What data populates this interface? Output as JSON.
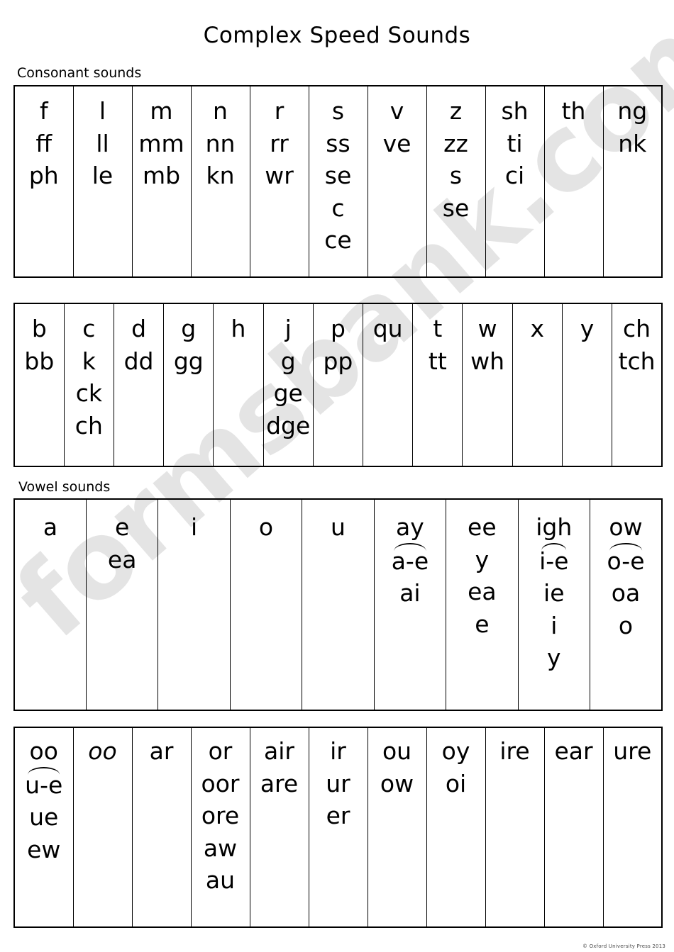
{
  "document": {
    "title": "Complex Speed Sounds",
    "copyright": "© Oxford University Press 2013",
    "watermark": "formsbank.com",
    "watermark_color": "#e4e4e4"
  },
  "sections": {
    "consonant_label": "Consonant sounds",
    "vowel_label": "Vowel sounds"
  },
  "tables": {
    "consonant_1": {
      "columns": [
        {
          "graphemes": [
            "f",
            "ff",
            "ph"
          ]
        },
        {
          "graphemes": [
            "l",
            "ll",
            "le"
          ]
        },
        {
          "graphemes": [
            "m",
            "mm",
            "mb"
          ]
        },
        {
          "graphemes": [
            "n",
            "nn",
            "kn"
          ]
        },
        {
          "graphemes": [
            "r",
            "rr",
            "wr"
          ]
        },
        {
          "graphemes": [
            "s",
            "ss",
            "se",
            "c",
            "ce"
          ]
        },
        {
          "graphemes": [
            "v",
            "ve"
          ]
        },
        {
          "graphemes": [
            "z",
            "zz",
            "s",
            "se"
          ]
        },
        {
          "graphemes": [
            "sh",
            "ti",
            "ci"
          ]
        },
        {
          "graphemes": [
            "th"
          ]
        },
        {
          "graphemes": [
            "ng",
            "nk"
          ]
        }
      ]
    },
    "consonant_2": {
      "columns": [
        {
          "graphemes": [
            "b",
            "bb"
          ]
        },
        {
          "graphemes": [
            "c",
            "k",
            "ck",
            "ch"
          ]
        },
        {
          "graphemes": [
            "d",
            "dd"
          ]
        },
        {
          "graphemes": [
            "g",
            "gg"
          ]
        },
        {
          "graphemes": [
            "h"
          ]
        },
        {
          "graphemes": [
            "j",
            "g",
            "ge",
            "dge"
          ]
        },
        {
          "graphemes": [
            "p",
            "pp"
          ]
        },
        {
          "graphemes": [
            "qu"
          ]
        },
        {
          "graphemes": [
            "t",
            "tt"
          ]
        },
        {
          "graphemes": [
            "w",
            "wh"
          ]
        },
        {
          "graphemes": [
            "x"
          ]
        },
        {
          "graphemes": [
            "y"
          ]
        },
        {
          "graphemes": [
            "ch",
            "tch"
          ]
        }
      ]
    },
    "vowel_1": {
      "columns": [
        {
          "graphemes": [
            "a"
          ]
        },
        {
          "graphemes": [
            "e",
            "ea"
          ]
        },
        {
          "graphemes": [
            "i"
          ]
        },
        {
          "graphemes": [
            "o"
          ]
        },
        {
          "graphemes": [
            "u"
          ]
        },
        {
          "graphemes": [
            "ay",
            "a-e",
            "ai"
          ],
          "arc_index": 1
        },
        {
          "graphemes": [
            "ee",
            "y",
            "ea",
            "e"
          ]
        },
        {
          "graphemes": [
            "igh",
            "i-e",
            "ie",
            "i",
            "y"
          ],
          "arc_index": 1
        },
        {
          "graphemes": [
            "ow",
            "o-e",
            "oa",
            "o"
          ],
          "arc_index": 1
        }
      ]
    },
    "vowel_2": {
      "columns": [
        {
          "graphemes": [
            "oo",
            "u-e",
            "ue",
            "ew"
          ],
          "arc_index": 1
        },
        {
          "graphemes": [
            "oo"
          ],
          "italic_index": 0
        },
        {
          "graphemes": [
            "ar"
          ]
        },
        {
          "graphemes": [
            "or",
            "oor",
            "ore",
            "aw",
            "au"
          ]
        },
        {
          "graphemes": [
            "air",
            "are"
          ]
        },
        {
          "graphemes": [
            "ir",
            "ur",
            "er"
          ]
        },
        {
          "graphemes": [
            "ou",
            "ow"
          ]
        },
        {
          "graphemes": [
            "oy",
            "oi"
          ]
        },
        {
          "graphemes": [
            "ire"
          ]
        },
        {
          "graphemes": [
            "ear"
          ]
        },
        {
          "graphemes": [
            "ure"
          ]
        }
      ]
    }
  }
}
